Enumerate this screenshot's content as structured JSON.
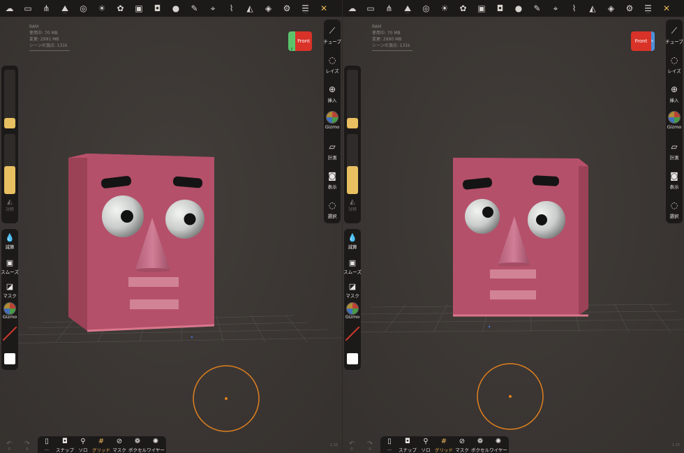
{
  "top_icons": [
    {
      "name": "cloud-icon",
      "glyph": "☁"
    },
    {
      "name": "folder-icon",
      "glyph": "▭"
    },
    {
      "name": "scene-tree-icon",
      "glyph": "⋔"
    },
    {
      "name": "mountain-icon",
      "glyph": "⛰",
      "dots": true
    },
    {
      "name": "wireframe-sphere-icon",
      "glyph": "◎"
    },
    {
      "name": "light-icon",
      "glyph": "☀"
    },
    {
      "name": "palette-icon",
      "glyph": "✿"
    },
    {
      "name": "image-icon",
      "glyph": "▣"
    },
    {
      "name": "camera-icon",
      "glyph": "◘"
    },
    {
      "name": "material-sphere-icon",
      "glyph": "●"
    },
    {
      "name": "brush-icon",
      "glyph": "✎"
    },
    {
      "name": "dropper-icon",
      "glyph": "⌖"
    },
    {
      "name": "smear-icon",
      "glyph": "⌇"
    },
    {
      "name": "triangle-icon",
      "glyph": "◭"
    },
    {
      "name": "layers-icon",
      "glyph": "◈"
    },
    {
      "name": "settings-icon",
      "glyph": "⚙"
    },
    {
      "name": "sliders-icon",
      "glyph": "☰",
      "dots": true
    },
    {
      "name": "tools-icon",
      "glyph": "✕",
      "accent": true
    }
  ],
  "right_tools": [
    {
      "name": "tube",
      "label": "チューブ",
      "glyph": "⟋"
    },
    {
      "name": "lathe",
      "label": "レイズ",
      "glyph": "◌"
    },
    {
      "name": "insert",
      "label": "挿入",
      "glyph": "⊕"
    },
    {
      "name": "gizmo",
      "label": "Gizmo",
      "glyph": ""
    },
    {
      "name": "measure",
      "label": "計測",
      "glyph": "▱"
    },
    {
      "name": "view",
      "label": "表示",
      "glyph": "◙"
    },
    {
      "name": "select",
      "label": "選択",
      "glyph": "◌"
    }
  ],
  "left_tools": [
    {
      "name": "decimate",
      "label": "減算",
      "glyph": "💧"
    },
    {
      "name": "smooth",
      "label": "スムーズ",
      "glyph": "▣"
    },
    {
      "name": "mask",
      "label": "マスク",
      "glyph": "◪"
    },
    {
      "name": "gizmo",
      "label": "Gizmo",
      "glyph": ""
    }
  ],
  "symmetry_label": "対称",
  "sliders": {
    "radius": 0.18,
    "intensity": 0.45
  },
  "bottom_items": [
    {
      "name": "document",
      "label": "...",
      "glyph": "▯"
    },
    {
      "name": "snap",
      "label": "スナップ",
      "glyph": "◘"
    },
    {
      "name": "solo",
      "label": "ソロ",
      "glyph": "⚲"
    },
    {
      "name": "grid",
      "label": "グリッド",
      "glyph": "#",
      "active": true
    },
    {
      "name": "mask",
      "label": "マスク",
      "glyph": "⊘"
    },
    {
      "name": "voxel",
      "label": "ボクセル",
      "glyph": "❁"
    },
    {
      "name": "wireframe",
      "label": "ワイヤー",
      "glyph": "✺"
    }
  ],
  "undo": {
    "undo_count": "0",
    "redo_count": "0"
  },
  "fps": "1.33",
  "colors": {
    "accent": "#e7b656",
    "cube_front": "#d93228",
    "slider_fill": "#e8c061",
    "cursor_ring": "#e0801f"
  },
  "panels": [
    {
      "id": "left",
      "stats": {
        "title": "RAM",
        "used": "使用中: 70 MB",
        "change": "変更: 2991 MB",
        "vertices": "シーンの頂点: 131k"
      },
      "view_cube": {
        "label": "Front",
        "side": "green"
      }
    },
    {
      "id": "right",
      "stats": {
        "title": "RAM",
        "used": "使用中: 70 MB",
        "change": "変更: 2990 MB",
        "vertices": "シーンの頂点: 131k"
      },
      "view_cube": {
        "label": "Front",
        "side": "blue"
      }
    }
  ]
}
